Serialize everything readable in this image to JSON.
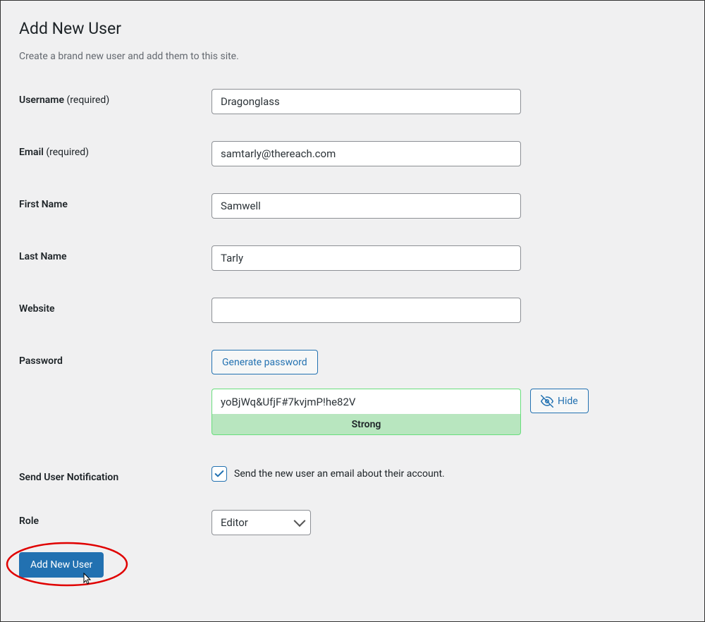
{
  "header": {
    "title": "Add New User",
    "description": "Create a brand new user and add them to this site."
  },
  "form": {
    "username": {
      "label": "Username",
      "required_text": "(required)",
      "value": "Dragonglass"
    },
    "email": {
      "label": "Email",
      "required_text": "(required)",
      "value": "samtarly@thereach.com"
    },
    "first_name": {
      "label": "First Name",
      "value": "Samwell"
    },
    "last_name": {
      "label": "Last Name",
      "value": "Tarly"
    },
    "website": {
      "label": "Website",
      "value": ""
    },
    "password": {
      "label": "Password",
      "generate_button": "Generate password",
      "value": "yoBjWq&UfjF#7kvjmP!he82V",
      "strength_text": "Strong",
      "hide_button": "Hide"
    },
    "notification": {
      "label": "Send User Notification",
      "checkbox_text": "Send the new user an email about their account.",
      "checked": true
    },
    "role": {
      "label": "Role",
      "selected": "Editor"
    }
  },
  "submit": {
    "button_text": "Add New User"
  }
}
